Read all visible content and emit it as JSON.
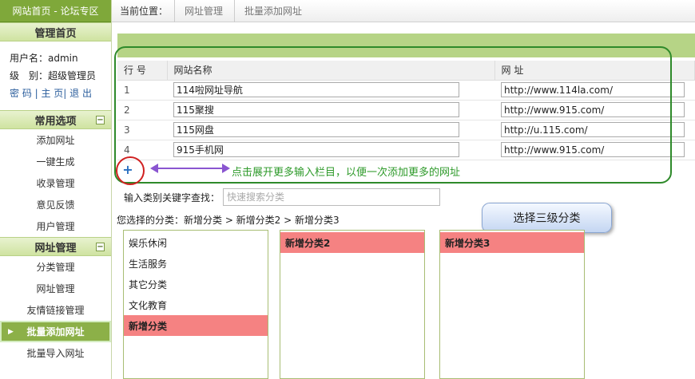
{
  "sidebar": {
    "site_tab": "网站首页 - 论坛专区",
    "admin_home": "管理首页",
    "user_line": "用户名：admin",
    "level_line": "级　别：超级管理员",
    "links_line": "密 码 | 主 页| 退 出",
    "common_section": "常用选项",
    "common_items": [
      "添加网址",
      "一键生成",
      "收录管理",
      "意见反馈",
      "用户管理"
    ],
    "url_section": "网址管理",
    "url_items": [
      "分类管理",
      "网址管理",
      "友情链接管理",
      "批量添加网址",
      "批量导入网址"
    ],
    "toggle": "−"
  },
  "topbar": {
    "location_label": "当前位置：",
    "crumbs": [
      "网址管理",
      "批量添加网址"
    ]
  },
  "table": {
    "headers": [
      "行 号",
      "网站名称",
      "网 址"
    ],
    "rows": [
      {
        "num": "1",
        "name": "114啦网址导航",
        "url": "http://www.114la.com/"
      },
      {
        "num": "2",
        "name": "115聚搜",
        "url": "http://www.915.com/"
      },
      {
        "num": "3",
        "name": "115网盘",
        "url": "http://u.115.com/"
      },
      {
        "num": "4",
        "name": "915手机网",
        "url": "http://www.915.com/"
      }
    ]
  },
  "add_button": "+",
  "hint": "点击展开更多输入栏目，以便一次添加更多的网址",
  "search": {
    "label": "输入类别关键字查找：",
    "placeholder": "快速搜索分类"
  },
  "selected_path": "您选择的分类：新增分类 > 新增分类2 > 新增分类3",
  "callout": "选择三级分类",
  "categories": {
    "level1": [
      "娱乐休闲",
      "生活服务",
      "其它分类",
      "文化教育",
      "新增分类"
    ],
    "level2": [
      "新增分类2"
    ],
    "level3": [
      "新增分类3"
    ]
  },
  "colors": {
    "accent_green": "#7fa83a",
    "selected_red": "#f58282",
    "hint_green": "#2e9a2a"
  }
}
